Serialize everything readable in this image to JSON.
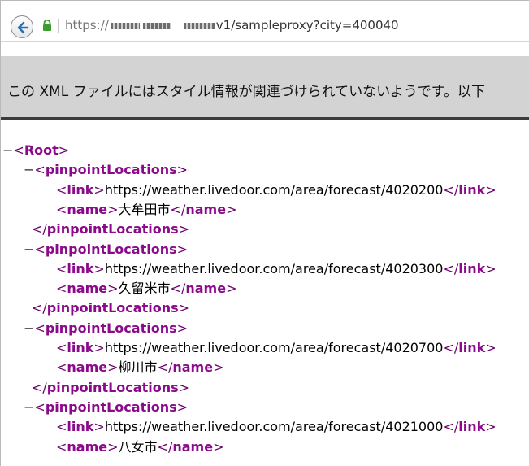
{
  "browser": {
    "url_prefix": "https://",
    "url_tail": "v1/sampleproxy?city=400040"
  },
  "infobar": {
    "message": "この XML ファイルにはスタイル情報が関連づけられていないようです。以下"
  },
  "xml": {
    "root_tag": "Root",
    "group_tag": "pinpointLocations",
    "link_tag": "link",
    "name_tag": "name",
    "toggle": "−",
    "locations": [
      {
        "link": "https://weather.livedoor.com/area/forecast/4020200",
        "name": "大牟田市"
      },
      {
        "link": "https://weather.livedoor.com/area/forecast/4020300",
        "name": "久留米市"
      },
      {
        "link": "https://weather.livedoor.com/area/forecast/4020700",
        "name": "柳川市"
      },
      {
        "link": "https://weather.livedoor.com/area/forecast/4021000",
        "name": "八女市"
      }
    ]
  }
}
